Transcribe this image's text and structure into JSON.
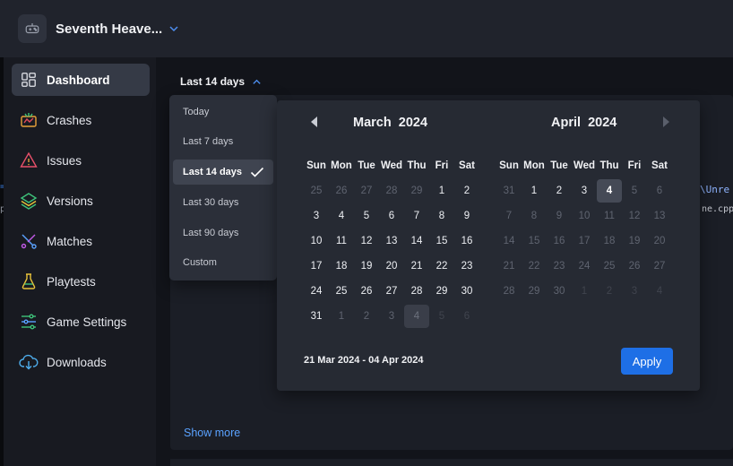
{
  "app": {
    "title": "Seventh Heave..."
  },
  "sidebar": {
    "items": [
      {
        "label": "Dashboard",
        "icon": "dashboard-icon",
        "active": true
      },
      {
        "label": "Crashes",
        "icon": "crashes-icon"
      },
      {
        "label": "Issues",
        "icon": "warning-icon"
      },
      {
        "label": "Versions",
        "icon": "layers-icon"
      },
      {
        "label": "Matches",
        "icon": "matches-icon"
      },
      {
        "label": "Playtests",
        "icon": "flask-icon"
      },
      {
        "label": "Game Settings",
        "icon": "sliders-icon"
      },
      {
        "label": "Downloads",
        "icon": "cloud-download-icon"
      }
    ]
  },
  "range_selector": {
    "label": "Last 14 days"
  },
  "dropdown": {
    "options": [
      {
        "label": "Today"
      },
      {
        "label": "Last 7 days"
      },
      {
        "label": "Last 14 days",
        "selected": true
      },
      {
        "label": "Last 30 days"
      },
      {
        "label": "Last 90 days"
      },
      {
        "label": "Custom"
      }
    ]
  },
  "calendar": {
    "weekdays": [
      "Sun",
      "Mon",
      "Tue",
      "Wed",
      "Thu",
      "Fri",
      "Sat"
    ],
    "months": [
      {
        "month": "March",
        "year": "2024",
        "weeks": [
          [
            "25",
            "26",
            "27",
            "28",
            "29",
            "1",
            "2"
          ],
          [
            "3",
            "4",
            "5",
            "6",
            "7",
            "8",
            "9"
          ],
          [
            "10",
            "11",
            "12",
            "13",
            "14",
            "15",
            "16"
          ],
          [
            "17",
            "18",
            "19",
            "20",
            "21",
            "22",
            "23"
          ],
          [
            "24",
            "25",
            "26",
            "27",
            "28",
            "29",
            "30"
          ],
          [
            "31",
            "1",
            "2",
            "3",
            "4",
            "5",
            "6"
          ]
        ]
      },
      {
        "month": "April",
        "year": "2024",
        "weeks": [
          [
            "31",
            "1",
            "2",
            "3",
            "4",
            "5",
            "6"
          ],
          [
            "7",
            "8",
            "9",
            "10",
            "11",
            "12",
            "13"
          ],
          [
            "14",
            "15",
            "16",
            "17",
            "18",
            "19",
            "20"
          ],
          [
            "21",
            "22",
            "23",
            "24",
            "25",
            "26",
            "27"
          ],
          [
            "28",
            "29",
            "30",
            "1",
            "2",
            "3",
            "4"
          ]
        ]
      }
    ],
    "selected_range": "21 Mar 2024 - 04 Apr 2024",
    "apply_label": "Apply"
  },
  "main": {
    "show_more": "Show more",
    "code_path": "\\Unre",
    "code_file": "ne.cpp"
  },
  "colors": {
    "accent": "#1e6fe6",
    "link": "#5aa2ff",
    "sidebar_bg": "#181a21",
    "popover_bg": "#262a33"
  }
}
